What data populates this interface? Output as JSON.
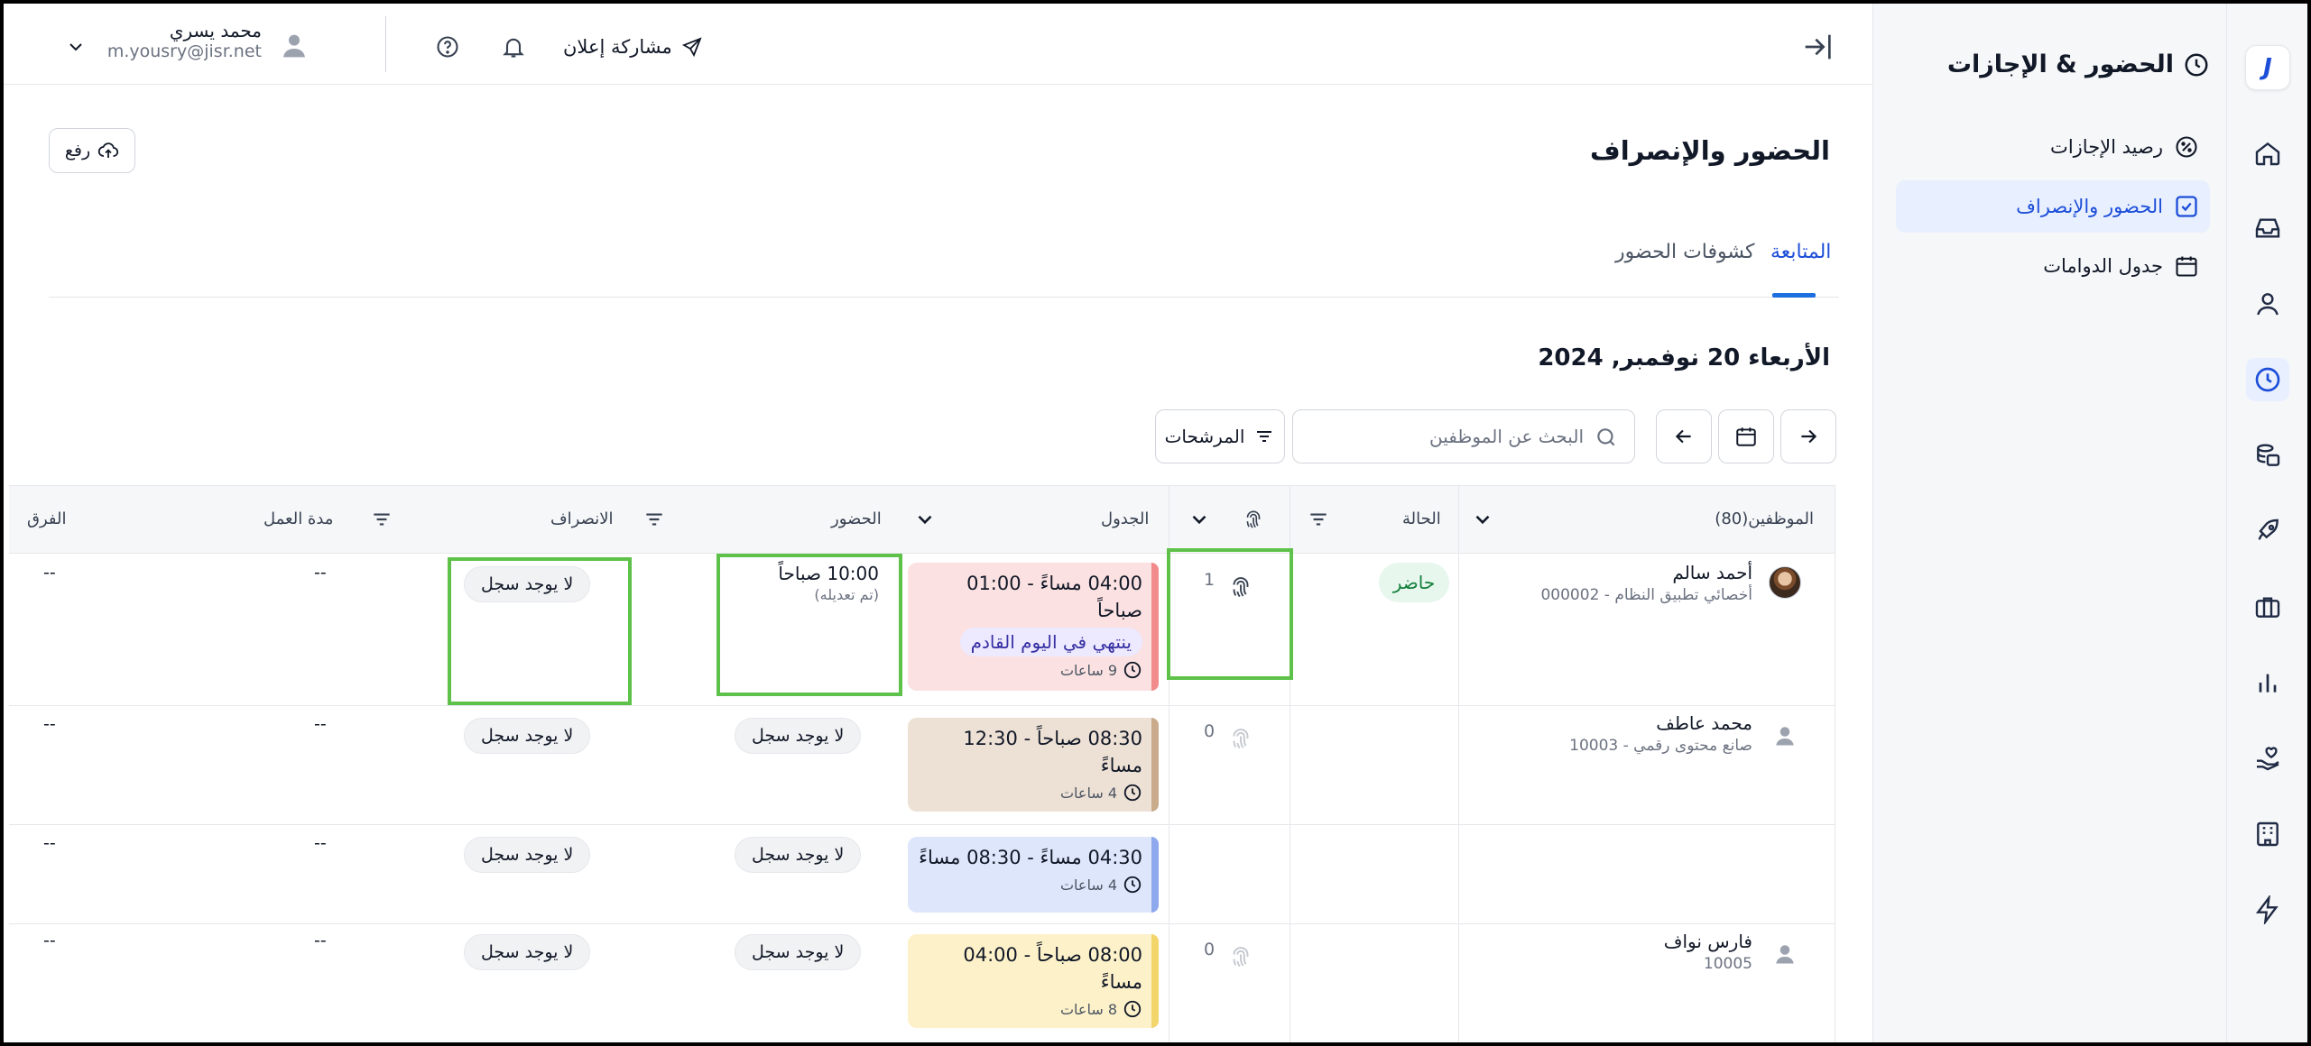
{
  "sidebar": {
    "title": "الحضور & الإجازات",
    "items": [
      {
        "label": "رصيد الإجازات"
      },
      {
        "label": "الحضور والإنصراف"
      },
      {
        "label": "جدول الدوامات"
      }
    ]
  },
  "topbar": {
    "share_label": "مشاركة إعلان",
    "user_name": "محمد يسري",
    "user_email": "m.yousry@jisr.net"
  },
  "page": {
    "title": "الحضور والإنصراف",
    "upload_label": "رفع",
    "tabs": [
      {
        "label": "المتابعة",
        "active": true
      },
      {
        "label": "كشوفات الحضور",
        "active": false
      }
    ],
    "date_heading": "الأربعاء 20 نوفمبر, 2024"
  },
  "toolbar": {
    "search_placeholder": "البحث عن الموظفين",
    "filters_label": "المرشحات"
  },
  "table": {
    "headers": {
      "employees": "الموظفين(80)",
      "status": "الحالة",
      "schedule": "الجدول",
      "checkin": "الحضور",
      "checkout": "الانصراف",
      "work_duration": "مدة العمل",
      "difference": "الفرق"
    },
    "rows": [
      {
        "name": "أحمد سالم",
        "subtitle": "أخصائي تطبيق النظام - 000002",
        "status": "حاضر",
        "punch_count": "1",
        "shift_time": "04:00 مساءً - 01:00 صباحاً",
        "shift_note": "ينتهي في اليوم القادم",
        "shift_hours": "9 ساعات",
        "checkin_time": "10:00 صباحاً",
        "checkin_note": "(تم تعديله)",
        "checkout": "لا يوجد سجل",
        "work_duration": "--",
        "difference": "--"
      },
      {
        "name": "محمد عاطف",
        "subtitle": "صانع محتوى رقمي - 10003",
        "punch_count": "0",
        "shift_time": "08:30 صباحاً - 12:30 مساءً",
        "shift_hours": "4 ساعات",
        "checkin": "لا يوجد سجل",
        "checkout": "لا يوجد سجل",
        "work_duration": "--",
        "difference": "--"
      },
      {
        "shift_time": "04:30 مساءً - 08:30 مساءً",
        "shift_hours": "4 ساعات",
        "checkin": "لا يوجد سجل",
        "checkout": "لا يوجد سجل",
        "work_duration": "--",
        "difference": "--"
      },
      {
        "name": "فارس نواف",
        "subtitle": "10005",
        "punch_count": "0",
        "shift_time": "08:00 صباحاً - 04:00 مساءً",
        "shift_hours": "8 ساعات",
        "checkin": "لا يوجد سجل",
        "checkout": "لا يوجد سجل",
        "work_duration": "--",
        "difference": "--"
      }
    ]
  },
  "colors": {
    "accent": "#1d6fe0",
    "present_green": "#15803d",
    "highlight_green": "#5ec24a",
    "shift_red": "#fbe1e1",
    "shift_brown": "#ede0d4",
    "shift_blue": "#dde6fb",
    "shift_yellow": "#fdf1c9"
  },
  "icons": [
    "logo-j",
    "home-icon",
    "inbox-icon",
    "user-icon",
    "clock-icon",
    "coins-icon",
    "rocket-icon",
    "briefcase-icon",
    "chart-icon",
    "hand-heart-icon",
    "building-icon",
    "bolt-icon",
    "fingerprint-icon",
    "calendar-icon",
    "search-icon",
    "filter-icon",
    "upload-icon",
    "bell-icon",
    "help-icon",
    "send-icon",
    "collapse-icon"
  ]
}
